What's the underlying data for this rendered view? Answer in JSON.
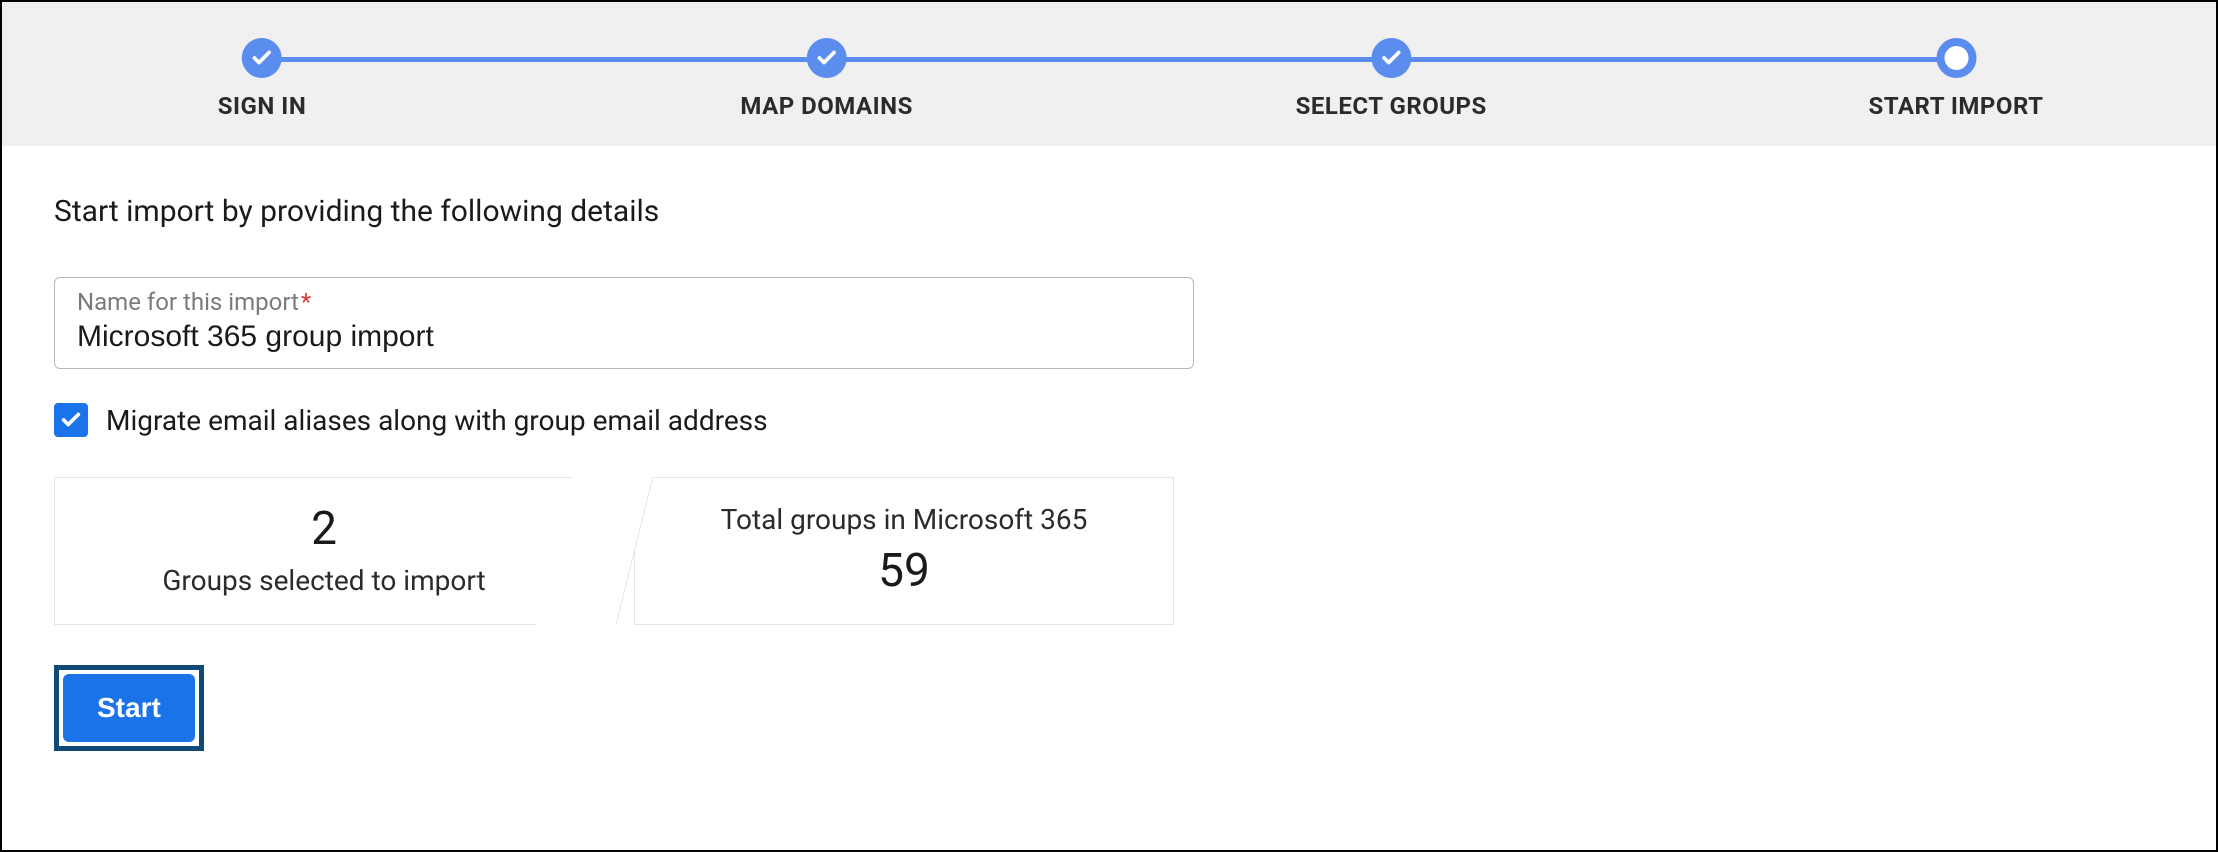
{
  "stepper": {
    "steps": [
      {
        "label": "SIGN IN",
        "state": "done"
      },
      {
        "label": "MAP DOMAINS",
        "state": "done"
      },
      {
        "label": "SELECT GROUPS",
        "state": "done"
      },
      {
        "label": "START IMPORT",
        "state": "current"
      }
    ]
  },
  "main": {
    "instruction": "Start import by providing the following details",
    "name_field": {
      "label": "Name for this import",
      "required_marker": "*",
      "value": "Microsoft 365 group import"
    },
    "migrate_checkbox": {
      "checked": true,
      "label": "Migrate email aliases along with group email address"
    },
    "stats": {
      "selected": {
        "value": "2",
        "label": "Groups selected to import"
      },
      "total": {
        "label": "Total groups in Microsoft 365",
        "value": "59"
      }
    },
    "start_button": "Start"
  }
}
